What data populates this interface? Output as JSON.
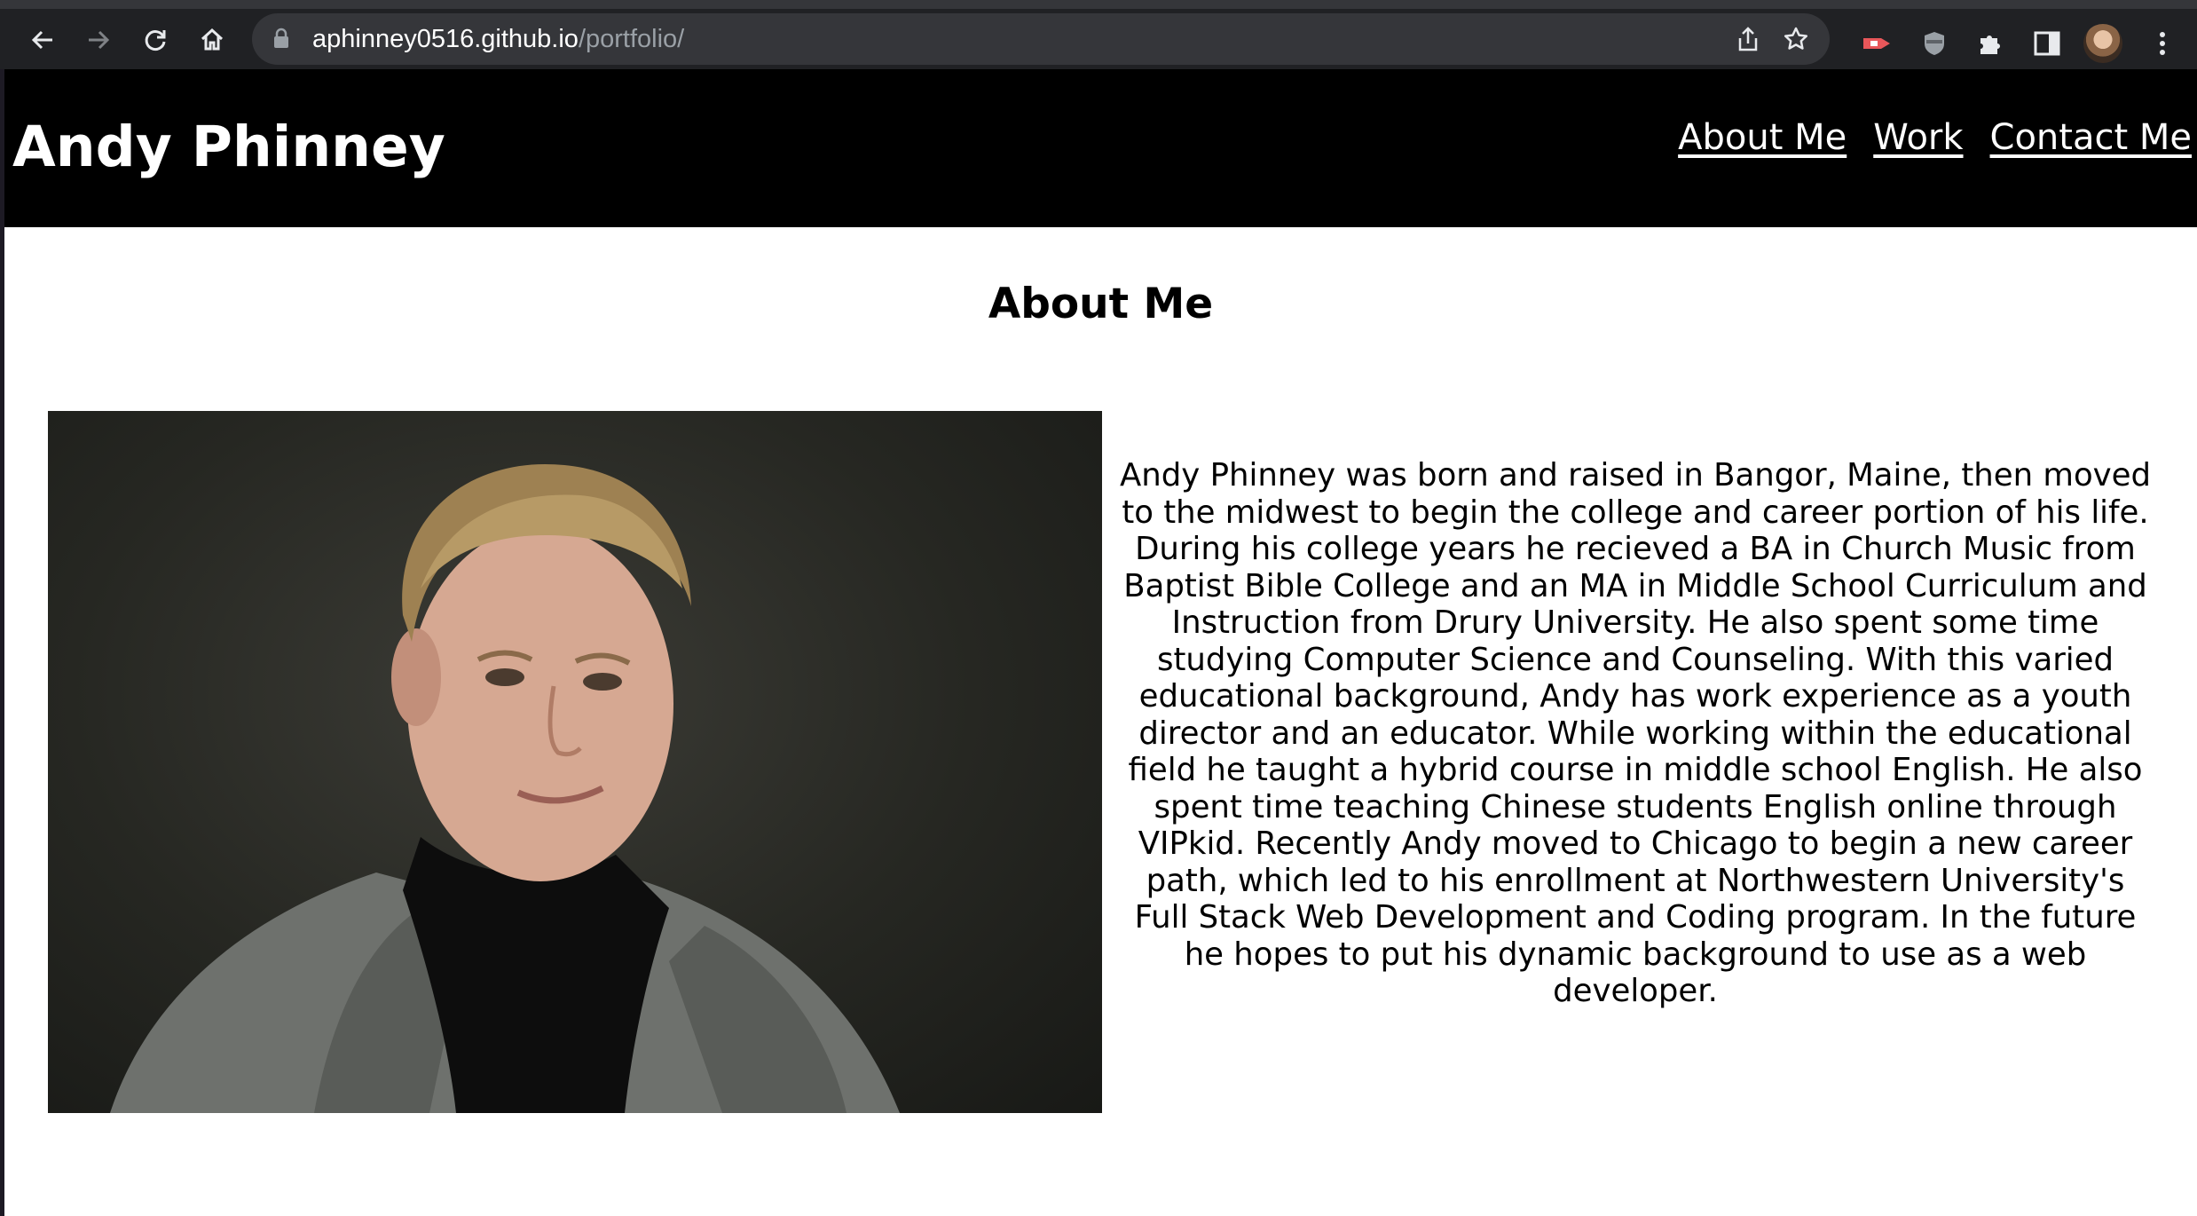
{
  "browser": {
    "url_host": "aphinney0516.github.io",
    "url_path": "/portfolio/",
    "icons": [
      "back-icon",
      "forward-icon",
      "reload-icon",
      "home-icon",
      "lock-icon",
      "share-icon",
      "star-icon",
      "extension-icon",
      "shield-icon",
      "puzzle-icon",
      "side-panel-icon",
      "profile-avatar",
      "more-menu-icon"
    ]
  },
  "header": {
    "title": "Andy Phinney",
    "nav": [
      {
        "label": "About Me"
      },
      {
        "label": "Work"
      },
      {
        "label": "Contact Me"
      }
    ]
  },
  "about": {
    "heading": "About Me",
    "bio": "Andy Phinney was born and raised in Bangor, Maine, then moved to the midwest to begin the college and career portion of his life. During his college years he recieved a BA in Church Music from Baptist Bible College and an MA in Middle School Curriculum and Instruction from Drury University. He also spent some time studying Computer Science and Counseling. With this varied educational background, Andy has work experience as a youth director and an educator. While working within the educational field he taught a hybrid course in middle school English. He also spent time teaching Chinese students English online through VIPkid. Recently Andy moved to Chicago to begin a new career path, which led to his enrollment at Northwestern University's Full Stack Web Development and Coding program. In the future he hopes to put his dynamic background to use as a web developer."
  },
  "colors": {
    "header_bg": "#000000",
    "header_text": "#ffffff",
    "chrome_bg": "#202124",
    "urlbar_bg": "#35363a"
  }
}
